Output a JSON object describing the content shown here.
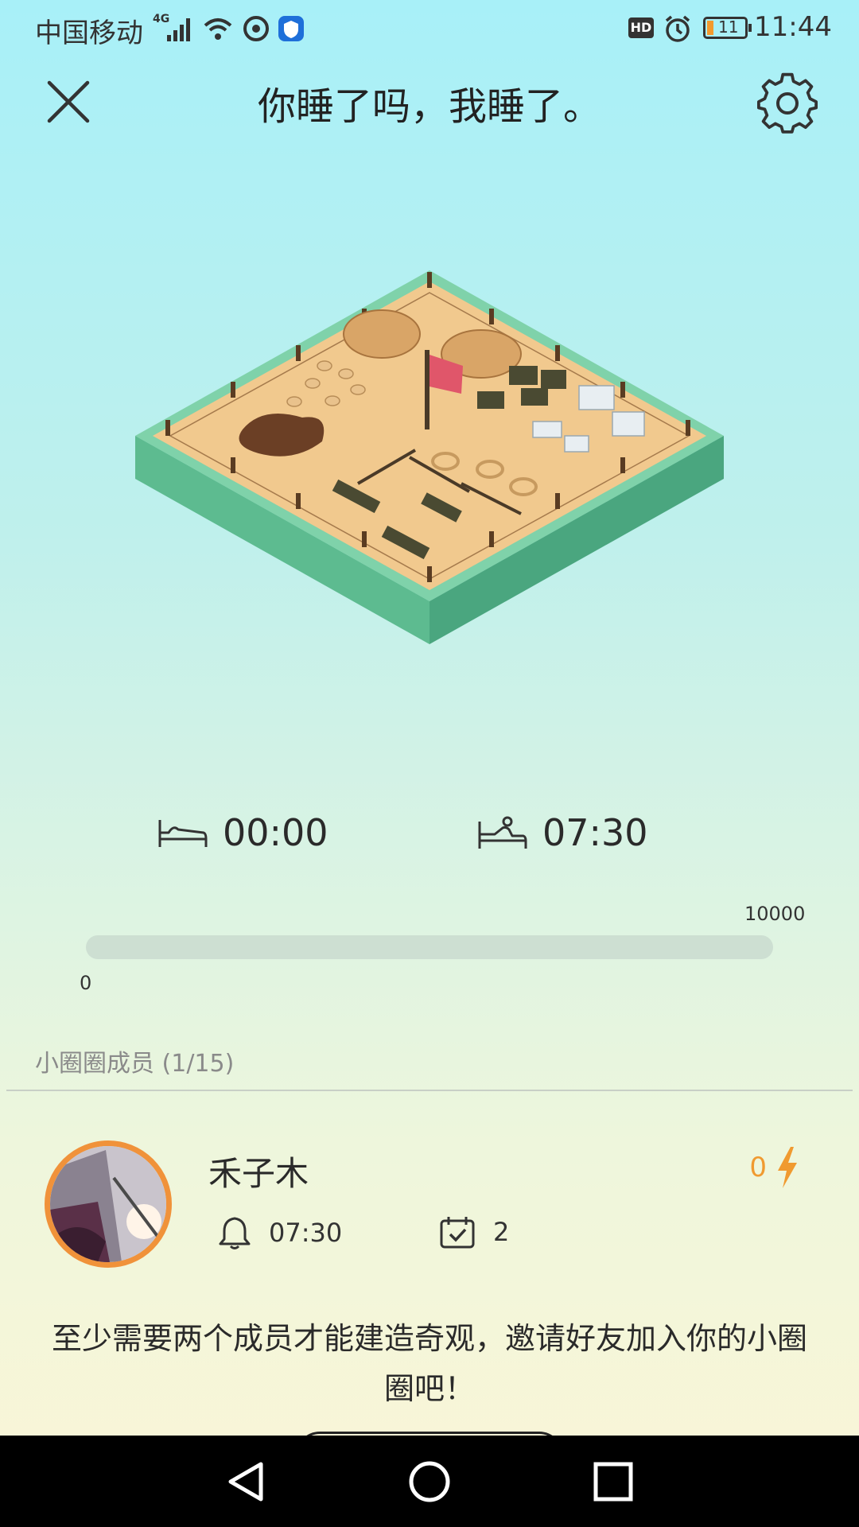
{
  "status_bar": {
    "carrier": "中国移动",
    "network": "4G",
    "hd_badge": "HD",
    "battery": "11",
    "time": "11:44"
  },
  "header": {
    "title": "你睡了吗，我睡了。",
    "close_icon": "close-icon",
    "settings_icon": "gear-icon"
  },
  "schedule": {
    "sleep_time": "00:00",
    "wake_time": "07:30"
  },
  "progress": {
    "min_label": "0",
    "max_label": "10000",
    "value": 0
  },
  "members": {
    "header": "小圈圈成员 (1/15)",
    "list": [
      {
        "name": "禾子木",
        "energy": "0",
        "alarm": "07:30",
        "checkins": "2"
      }
    ]
  },
  "invite": {
    "message": "至少需要两个成员才能建造奇观，邀请好友加入你的小圈圈吧！"
  },
  "colors": {
    "accent": "#f39a2e",
    "track": "#cddfd2",
    "ground_top": "#f1c98e",
    "grass": "#6bc9a0"
  }
}
